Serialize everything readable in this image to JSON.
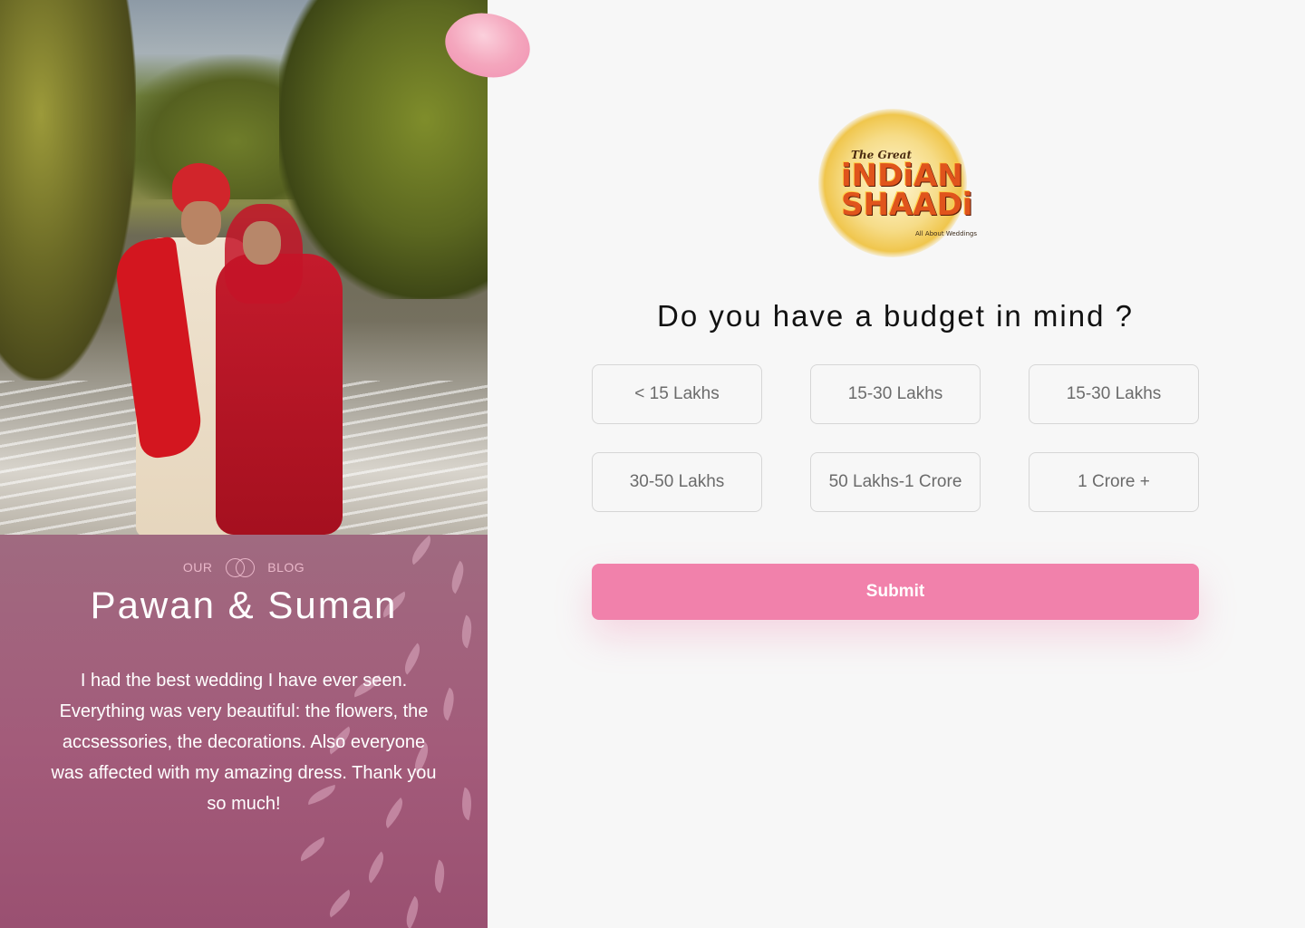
{
  "blog": {
    "tag_left": "OUR",
    "tag_right": "BLOG",
    "title": "Pawan & Suman",
    "testimonial": "I had the best wedding I have ever seen. Everything was very beautiful: the flowers, the accsessories, the decorations. Also everyone was affected with my amazing dress. Thank you so much!"
  },
  "logo": {
    "small": "The Great",
    "main_line1": "iNDiAN",
    "main_line2": "SHAADi",
    "tagline": "All About Weddings"
  },
  "question": "Do you have a budget in mind ?",
  "options": [
    "< 15 Lakhs",
    "15-30 Lakhs",
    "15-30 Lakhs",
    "30-50 Lakhs",
    "50 Lakhs-1 Crore",
    "1 Crore +"
  ],
  "submit_label": "Submit",
  "colors": {
    "accent": "#f181ab",
    "blog_panel": "#a35b7a"
  }
}
